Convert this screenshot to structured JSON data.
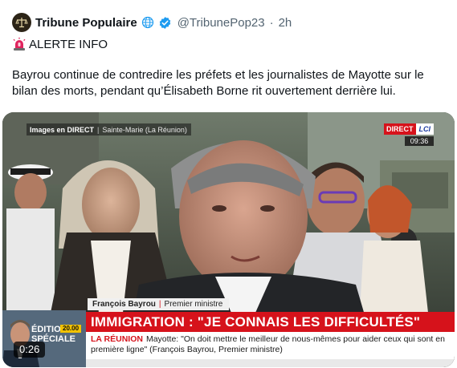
{
  "header": {
    "display_name": "Tribune Populaire",
    "handle": "@TribunePop23",
    "separator": "·",
    "time": "2h",
    "icons": [
      "scales-avatar-icon",
      "globe-icon",
      "verified-badge-icon"
    ],
    "verified_color": "#1d9bf0"
  },
  "alert": {
    "icon": "rotating-light-icon",
    "label": "ALERTE INFO"
  },
  "body_text": "Bayrou continue de contredire les préfets et les journalistes de Mayotte sur le bilan des morts, pendant qu’Élisabeth Borne rit ouvertement derrière lui.",
  "video": {
    "live_label": "Images en DIRECT",
    "location": "Sainte-Marie (La Réunion)",
    "direct_badge": "DIRECT",
    "channel_logo": "LCI",
    "clock": "09:36",
    "speaker_name": "François Bayrou",
    "speaker_title": "Premier ministre",
    "headline": "IMMIGRATION : \"JE CONNAIS LES DIFFICULTÉS\"",
    "subtitle_region": "LA RÉUNION",
    "subtitle_text": "Mayotte: \"On doit mettre le meilleur de nous-mêmes pour aider ceux qui sont en première ligne\" (François Bayrou, Premier ministre)",
    "thumb_text": "ÉDITION\nSPÉCIALE",
    "thumb_hour": "20.00",
    "duration": "0:26",
    "accent_red": "#d6121b"
  }
}
